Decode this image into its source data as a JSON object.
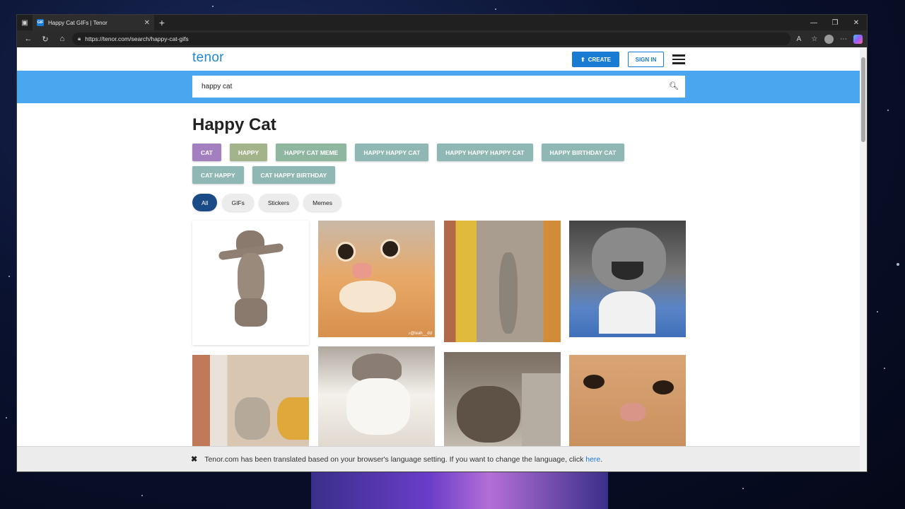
{
  "browser": {
    "tab_title": "Happy Cat GIFs | Tenor",
    "favicon_text": "GIF",
    "url": "https://tenor.com/search/happy-cat-gifs"
  },
  "header": {
    "logo": "tenor",
    "create_label": "CREATE",
    "signin_label": "SIGN IN"
  },
  "search": {
    "value": "happy cat"
  },
  "page_title": "Happy Cat",
  "tags": [
    {
      "label": "CAT",
      "color": "#a47fbf"
    },
    {
      "label": "HAPPY",
      "color": "#a3b38a"
    },
    {
      "label": "HAPPY CAT MEME",
      "color": "#8fb79f"
    },
    {
      "label": "HAPPY HAPPY CAT",
      "color": "#8fb7b4"
    },
    {
      "label": "HAPPY HAPPY HAPPY CAT",
      "color": "#8fb7b4"
    },
    {
      "label": "HAPPY BIRTHDAY CAT",
      "color": "#8fb7b4"
    },
    {
      "label": "CAT HAPPY",
      "color": "#8fb7b4"
    },
    {
      "label": "CAT HAPPY BIRTHDAY",
      "color": "#8fb7b4"
    }
  ],
  "filters": [
    {
      "label": "All",
      "active": true
    },
    {
      "label": "GIFs",
      "active": false
    },
    {
      "label": "Stickers",
      "active": false
    },
    {
      "label": "Memes",
      "active": false
    }
  ],
  "gif_watermark": "♪@leah__dd",
  "notice": {
    "text": "Tenor.com has been translated based on your browser's language setting. If you want to change the language, click",
    "link": "here",
    "end": "."
  }
}
